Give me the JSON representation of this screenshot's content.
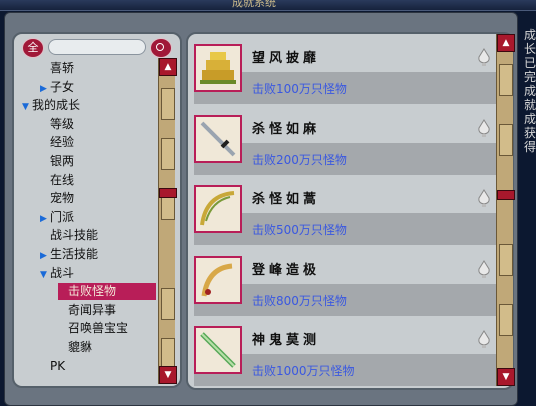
{
  "window": {
    "title": "成就系统"
  },
  "search": {
    "all_label": "全",
    "placeholder": ""
  },
  "tree": [
    {
      "label": "喜轿",
      "indent": 2,
      "arrow": ""
    },
    {
      "label": "子女",
      "indent": 2,
      "arrow": "right"
    },
    {
      "label": "我的成长",
      "indent": 0,
      "arrow": "down"
    },
    {
      "label": "等级",
      "indent": 2,
      "arrow": ""
    },
    {
      "label": "经验",
      "indent": 2,
      "arrow": ""
    },
    {
      "label": "银两",
      "indent": 2,
      "arrow": ""
    },
    {
      "label": "在线",
      "indent": 2,
      "arrow": ""
    },
    {
      "label": "宠物",
      "indent": 2,
      "arrow": ""
    },
    {
      "label": "门派",
      "indent": 2,
      "arrow": "right"
    },
    {
      "label": "战斗技能",
      "indent": 2,
      "arrow": ""
    },
    {
      "label": "生活技能",
      "indent": 2,
      "arrow": "right"
    },
    {
      "label": "战斗",
      "indent": 2,
      "arrow": "down"
    },
    {
      "label": "击败怪物",
      "indent": 4,
      "arrow": "",
      "selected": true
    },
    {
      "label": "奇闻异事",
      "indent": 4,
      "arrow": ""
    },
    {
      "label": "召唤兽宝宝",
      "indent": 4,
      "arrow": ""
    },
    {
      "label": "貔貅",
      "indent": 4,
      "arrow": ""
    },
    {
      "label": "PK",
      "indent": 2,
      "arrow": ""
    }
  ],
  "achievements": [
    {
      "name": "望风披靡",
      "desc": "击败100万只怪物",
      "icon": "tower-icon"
    },
    {
      "name": "杀怪如麻",
      "desc": "击败200万只怪物",
      "icon": "sword-icon"
    },
    {
      "name": "杀怪如蒿",
      "desc": "击败500万只怪物",
      "icon": "bow-icon"
    },
    {
      "name": "登峰造极",
      "desc": "击败800万只怪物",
      "icon": "blade-icon"
    },
    {
      "name": "神鬼莫测",
      "desc": "击败1000万只怪物",
      "icon": "dagger-icon"
    }
  ],
  "side_text": "成长已完成就成获得",
  "colors": {
    "accent": "#b81e58",
    "desc_text": "#3a58e0",
    "panel": "#c8cdd0",
    "row_band": "#a4a8ac"
  }
}
